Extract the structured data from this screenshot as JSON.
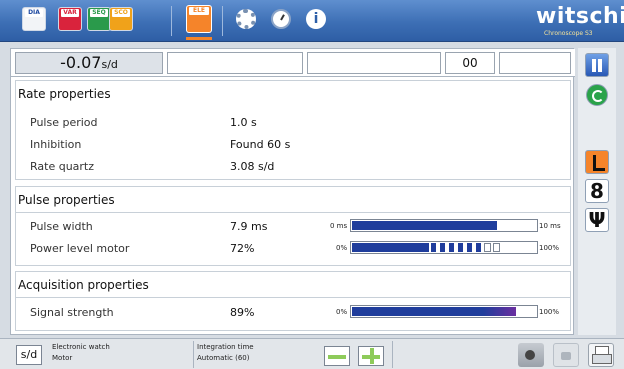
{
  "toolbar": {
    "buttons": [
      {
        "name": "dia-button",
        "label": "DIA"
      },
      {
        "name": "var-button",
        "label": "VAR"
      },
      {
        "name": "seq-button",
        "label": "SEQ"
      },
      {
        "name": "sco-button",
        "label": "SCO"
      },
      {
        "name": "ele-button",
        "label": "ELE"
      }
    ],
    "icons": [
      "settings-gear-icon",
      "clock-icon",
      "info-icon"
    ],
    "info_glyph": "i",
    "logo_text": "witschi",
    "logo_sub": "Chronoscope S3",
    "accent_color": "#f5842a",
    "bar_color": "#3d6fb5"
  },
  "rate": {
    "value": "-0.07",
    "unit": "s/d",
    "box4": "00"
  },
  "rate_properties": {
    "title": "Rate properties",
    "items": [
      {
        "label": "Pulse period",
        "value": "1.0 s"
      },
      {
        "label": "Inhibition",
        "value": "Found 60 s"
      },
      {
        "label": "Rate quartz",
        "value": "3.08 s/d"
      }
    ]
  },
  "pulse_properties": {
    "title": "Pulse properties",
    "width_label": "Pulse width",
    "width_value": "7.9 ms",
    "width_bar": {
      "min": "0 ms",
      "max": "10 ms",
      "fraction": 0.79
    },
    "power_label": "Power level motor",
    "power_value": "72%",
    "power_bar": {
      "min": "0%",
      "max": "100%",
      "fraction": 0.72
    }
  },
  "acquisition_properties": {
    "title": "Acquisition properties",
    "signal_label": "Signal strength",
    "signal_value": "89%",
    "signal_bar": {
      "min": "0%",
      "max": "100%",
      "fraction": 0.89
    }
  },
  "side_panel": {
    "digit": "8",
    "fork": "Ψ"
  },
  "bottom": {
    "sd_label": "s/d",
    "watch_type": "Electronic watch",
    "watch_sub": "Motor",
    "integration_label": "Integration time",
    "integration_value": "Automatic (60)"
  }
}
